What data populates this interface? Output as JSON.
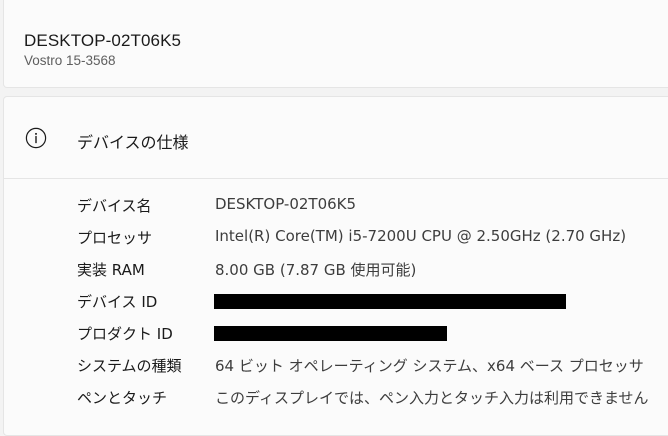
{
  "device": {
    "name": "DESKTOP-02T06K5",
    "model": "Vostro 15-3568"
  },
  "specs": {
    "title": "デバイスの仕様",
    "icon": "info-icon",
    "rows": [
      {
        "label": "デバイス名",
        "value": "DESKTOP-02T06K5"
      },
      {
        "label": "プロセッサ",
        "value": "Intel(R) Core(TM) i5-7200U CPU @ 2.50GHz (2.70 GHz)"
      },
      {
        "label": "実装 RAM",
        "value": "8.00 GB (7.87 GB 使用可能)"
      },
      {
        "label": "デバイス ID",
        "value": ""
      },
      {
        "label": "プロダクト ID",
        "value": ""
      },
      {
        "label": "システムの種類",
        "value": "64 ビット オペレーティング システム、x64 ベース プロセッサ"
      },
      {
        "label": "ペンとタッチ",
        "value": "このディスプレイでは、ペン入力とタッチ入力は利用できません"
      }
    ]
  },
  "colors": {
    "background": "#f3f3f3",
    "card": "#fbfbfb",
    "redaction": "#000000"
  }
}
